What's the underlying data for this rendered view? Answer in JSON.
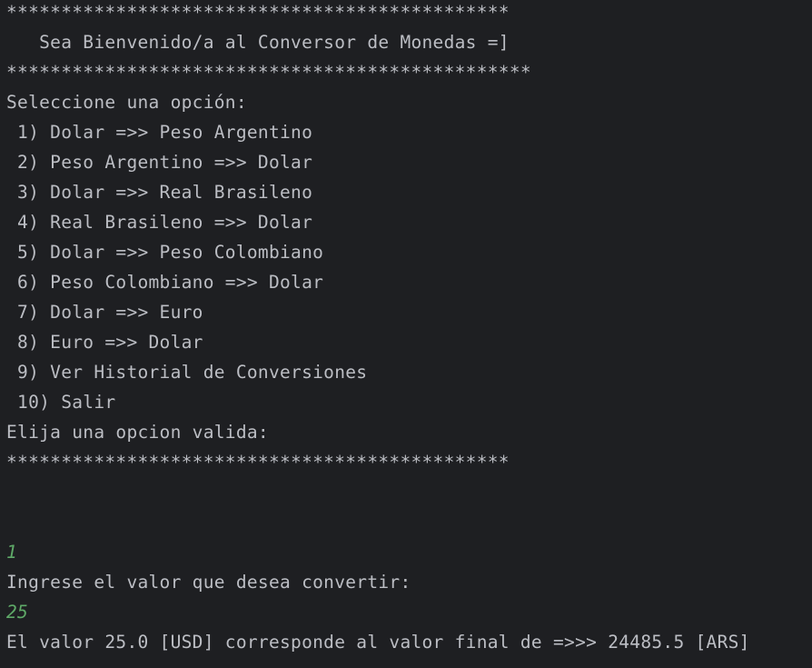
{
  "console": {
    "lines": [
      {
        "text": "**********************************************",
        "kind": "output"
      },
      {
        "text": "   Sea Bienvenido/a al Conversor de Monedas =]",
        "kind": "output"
      },
      {
        "text": "************************************************",
        "kind": "output"
      },
      {
        "text": "Seleccione una opción:",
        "kind": "output"
      },
      {
        "text": " 1) Dolar =>> Peso Argentino",
        "kind": "output"
      },
      {
        "text": " 2) Peso Argentino =>> Dolar",
        "kind": "output"
      },
      {
        "text": " 3) Dolar =>> Real Brasileno",
        "kind": "output"
      },
      {
        "text": " 4) Real Brasileno =>> Dolar",
        "kind": "output"
      },
      {
        "text": " 5) Dolar =>> Peso Colombiano",
        "kind": "output"
      },
      {
        "text": " 6) Peso Colombiano =>> Dolar",
        "kind": "output"
      },
      {
        "text": " 7) Dolar =>> Euro",
        "kind": "output"
      },
      {
        "text": " 8) Euro =>> Dolar",
        "kind": "output"
      },
      {
        "text": " 9) Ver Historial de Conversiones",
        "kind": "output"
      },
      {
        "text": " 10) Salir",
        "kind": "output"
      },
      {
        "text": "Elija una opcion valida:",
        "kind": "output"
      },
      {
        "text": "**********************************************",
        "kind": "output"
      },
      {
        "text": "",
        "kind": "output"
      },
      {
        "text": "",
        "kind": "output"
      },
      {
        "text": "1",
        "kind": "input"
      },
      {
        "text": "Ingrese el valor que desea convertir:",
        "kind": "output"
      },
      {
        "text": "25",
        "kind": "input"
      },
      {
        "text": "El valor 25.0 [USD] corresponde al valor final de =>>> 24485.5 [ARS]",
        "kind": "output"
      }
    ]
  }
}
